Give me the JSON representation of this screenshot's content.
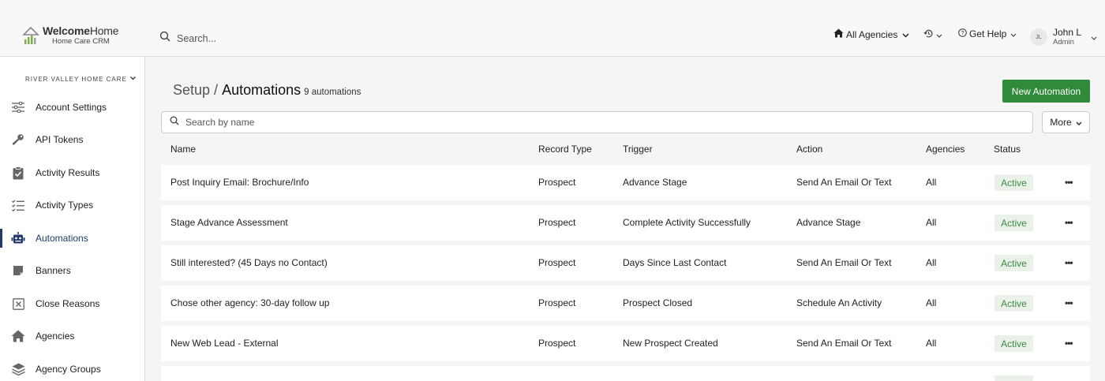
{
  "app": {
    "logo_title_bold": "Welcome",
    "logo_title_light": "Home",
    "logo_sub": "Home Care CRM"
  },
  "topbar": {
    "search_placeholder": "Search...",
    "agencies_label": "All Agencies",
    "help_label": "Get Help",
    "user_initials": "JL",
    "user_name": "John L",
    "user_role": "Admin"
  },
  "sidebar": {
    "org_name": "RIVER VALLEY HOME CARE",
    "items": [
      {
        "label": "Account Settings",
        "icon": "sliders-icon"
      },
      {
        "label": "API Tokens",
        "icon": "key-icon"
      },
      {
        "label": "Activity Results",
        "icon": "clipboard-check-icon"
      },
      {
        "label": "Activity Types",
        "icon": "checklist-icon"
      },
      {
        "label": "Automations",
        "icon": "robot-icon"
      },
      {
        "label": "Banners",
        "icon": "banner-icon"
      },
      {
        "label": "Close Reasons",
        "icon": "close-box-icon"
      },
      {
        "label": "Agencies",
        "icon": "home-icon"
      },
      {
        "label": "Agency Groups",
        "icon": "layers-icon"
      }
    ],
    "active_index": 4
  },
  "page": {
    "breadcrumb_parent": "Setup",
    "breadcrumb_sep": "/",
    "title": "Automations",
    "count_text": "9 automations",
    "new_button": "New Automation",
    "search_placeholder": "Search by name",
    "more_button": "More"
  },
  "table": {
    "columns": [
      "Name",
      "Record Type",
      "Trigger",
      "Action",
      "Agencies",
      "Status"
    ],
    "rows": [
      {
        "name": "Post Inquiry Email: Brochure/Info",
        "record_type": "Prospect",
        "trigger": "Advance Stage",
        "action": "Send An Email Or Text",
        "agencies": "All",
        "status": "Active"
      },
      {
        "name": "Stage Advance Assessment",
        "record_type": "Prospect",
        "trigger": "Complete Activity Successfully",
        "action": "Advance Stage",
        "agencies": "All",
        "status": "Active"
      },
      {
        "name": "Still interested? (45 Days no Contact)",
        "record_type": "Prospect",
        "trigger": "Days Since Last Contact",
        "action": "Send An Email Or Text",
        "agencies": "All",
        "status": "Active"
      },
      {
        "name": "Chose other agency: 30-day follow up",
        "record_type": "Prospect",
        "trigger": "Prospect Closed",
        "action": "Schedule An Activity",
        "agencies": "All",
        "status": "Active"
      },
      {
        "name": "New Web Lead - External",
        "record_type": "Prospect",
        "trigger": "New Prospect Created",
        "action": "Send An Email Or Text",
        "agencies": "All",
        "status": "Active"
      }
    ]
  },
  "colors": {
    "accent_green": "#2f8a3a",
    "active_nav": "#1f3a6b",
    "status_bg": "#e9f1e9",
    "status_text": "#3a8a44"
  }
}
